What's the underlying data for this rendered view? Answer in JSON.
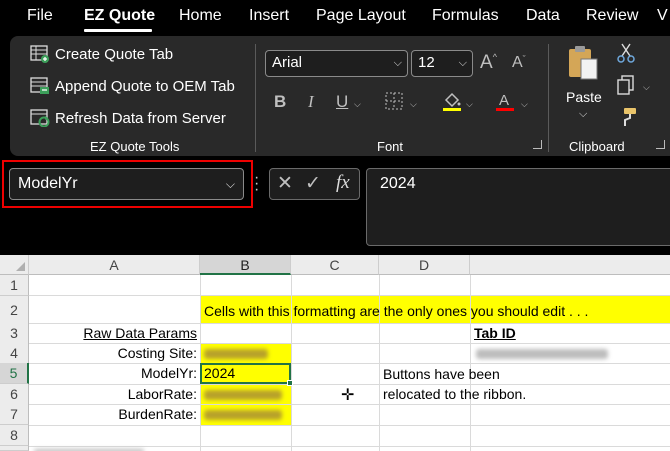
{
  "menu": {
    "tabs": [
      "File",
      "EZ Quote",
      "Home",
      "Insert",
      "Page Layout",
      "Formulas",
      "Data",
      "Review",
      "V"
    ],
    "active": "EZ Quote"
  },
  "ribbon": {
    "ez_quote": {
      "buttons": [
        "Create Quote Tab",
        "Append Quote to OEM Tab",
        "Refresh Data from Server"
      ],
      "label": "EZ Quote Tools"
    },
    "font": {
      "name": "Arial",
      "size": "12",
      "label": "Font"
    },
    "clipboard": {
      "paste": "Paste",
      "label": "Clipboard"
    }
  },
  "formula_bar": {
    "name_box": "ModelYr",
    "formula": "2024"
  },
  "sheet": {
    "columns": [
      "A",
      "B",
      "C",
      "D"
    ],
    "rows": [
      "1",
      "2",
      "3",
      "4",
      "5",
      "6",
      "7",
      "8"
    ],
    "selected_cell": "B5",
    "banner": "Cells with this formatting are the only ones you should edit . . .",
    "raw_header": "Raw Data Params",
    "tab_id_header": "Tab ID",
    "labels": [
      "Costing Site:",
      "ModelYr:",
      "LaborRate:",
      "BurdenRate:"
    ],
    "b5_value": "2024",
    "note_line1": "Buttons have been",
    "note_line2": "relocated to the ribbon."
  },
  "colors": {
    "accent_green": "#217346",
    "highlight_yellow": "#ffff00",
    "callout_red": "#ee0000"
  },
  "icons": [
    "create-tab-icon",
    "append-icon",
    "refresh-icon",
    "grow-font-icon",
    "shrink-font-icon",
    "bold-icon",
    "italic-icon",
    "underline-icon",
    "borders-icon",
    "fill-color-icon",
    "font-color-icon",
    "paste-icon",
    "cut-icon",
    "copy-icon",
    "format-painter-icon",
    "cancel-icon",
    "enter-icon",
    "insert-function-icon"
  ]
}
